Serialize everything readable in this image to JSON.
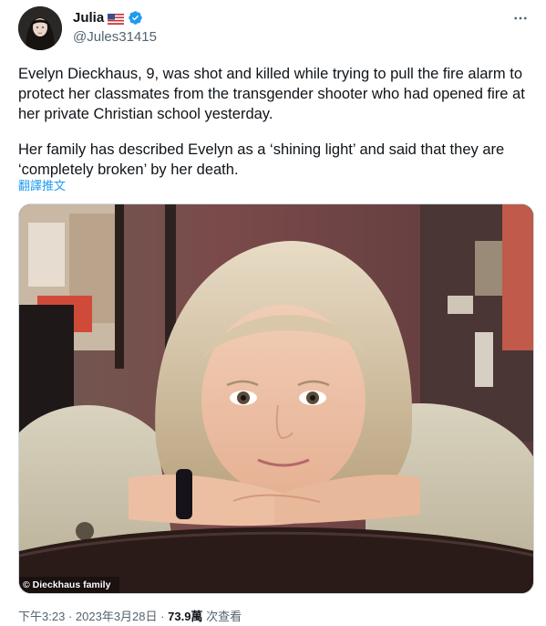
{
  "user": {
    "display_name": "Julia",
    "handle": "@Jules31415",
    "flag_icon": "us-flag-icon",
    "verified_icon": "verified-badge-icon",
    "verified_color": "#1d9bf0"
  },
  "tweet": {
    "paragraphs": [
      "Evelyn Dieckhaus, 9, was shot and killed while trying to pull the fire alarm to protect her classmates from the transgender shooter who had opened fire at her private Christian school yesterday.",
      "Her family has described Evelyn as a ‘shining light’ and said that they are ‘completely broken’ by her death."
    ],
    "translate_label": "翻譯推文",
    "link_color": "#1d9bf0"
  },
  "media": {
    "credit": "© Dieckhaus family"
  },
  "meta": {
    "time": "下午3:23",
    "separator": "·",
    "date": "2023年3月28日",
    "views_count": "73.9萬",
    "views_label": "次查看"
  },
  "menu": {
    "more_icon": "more-dots-icon"
  }
}
